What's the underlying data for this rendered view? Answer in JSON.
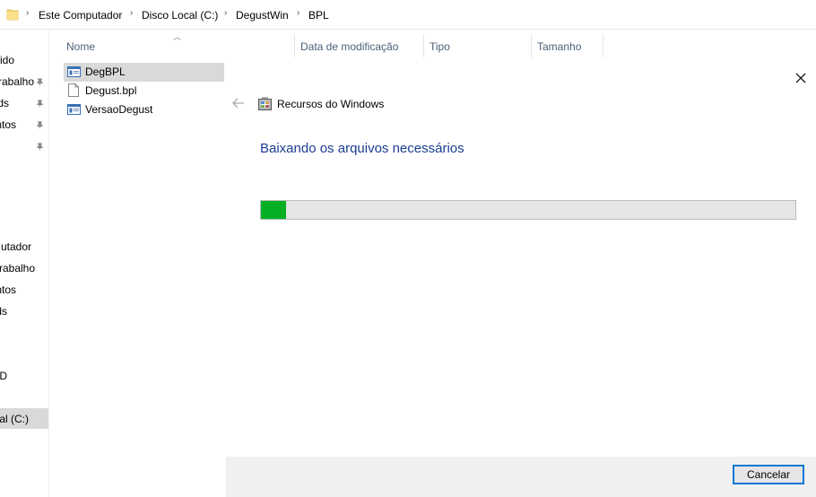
{
  "breadcrumb": {
    "items": [
      "Este Computador",
      "Disco Local (C:)",
      "DegustWin",
      "BPL"
    ]
  },
  "navpane": {
    "items": [
      "ido",
      "rabalho",
      "ds",
      "ntos",
      "utador",
      "rabalho",
      "ntos",
      "ds",
      "D",
      "cal (C:)"
    ]
  },
  "filelist": {
    "columns": [
      "Nome",
      "Data de modificação",
      "Tipo",
      "Tamanho"
    ],
    "files": [
      "DegBPL",
      "Degust.bpl",
      "VersaoDegust"
    ]
  },
  "dialog": {
    "app_title": "Recursos do Windows",
    "heading": "Baixando os arquivos necessários",
    "progress": 0.047,
    "cancel_label": "Cancelar"
  },
  "colors": {
    "accent": "#0078d7",
    "heading": "#1a3d91",
    "progress_fill": "#06b025",
    "progress_track": "#e6e6e6"
  }
}
